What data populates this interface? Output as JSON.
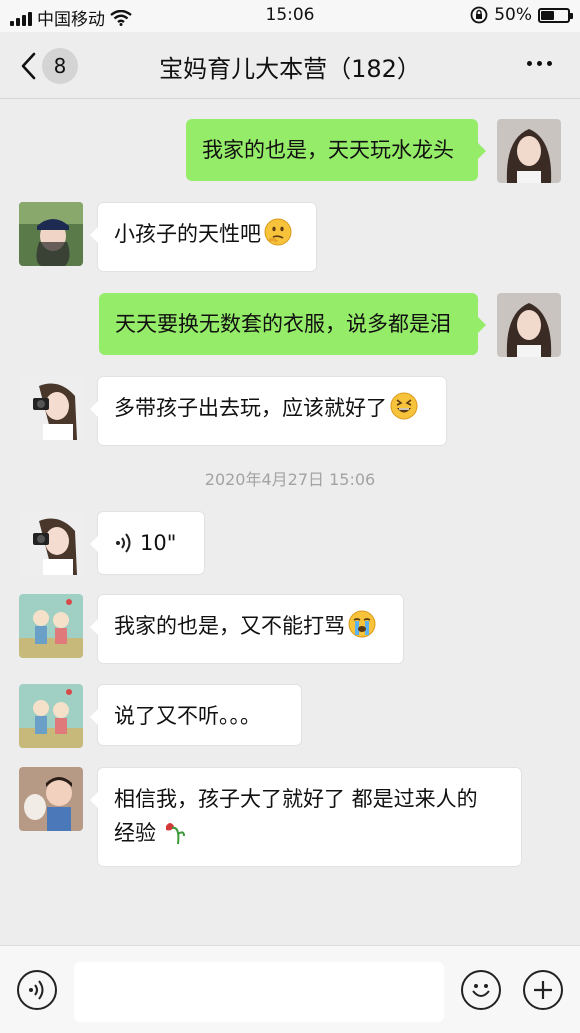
{
  "status_bar": {
    "carrier": "中国移动",
    "time": "15:06",
    "battery": "50%",
    "battery_level": 0.5
  },
  "nav": {
    "back_count": "8",
    "title": "宝妈育儿大本营（182）"
  },
  "messages": [
    {
      "side": "right",
      "text": "我家的也是，天天玩水龙头",
      "avatar": "avatar-girl-long-hair"
    },
    {
      "side": "left",
      "text": "小孩子的天性吧",
      "emoji": "thinking-face-emoji",
      "avatar": "avatar-girl-cap"
    },
    {
      "side": "right",
      "text": "天天要换无数套的衣服，说多都是泪",
      "avatar": "avatar-girl-long-hair"
    },
    {
      "side": "left",
      "text": "多带孩子出去玩，应该就好了",
      "emoji": "grinning-squint-emoji",
      "avatar": "avatar-girl-camera"
    },
    {
      "side": "left",
      "voice": "10\"",
      "avatar": "avatar-girl-camera"
    },
    {
      "side": "left",
      "text": "我家的也是，又不能打骂",
      "emoji": "crying-face-emoji",
      "avatar": "avatar-cartoon-couple"
    },
    {
      "side": "left",
      "text": "说了又不听。。。",
      "avatar": "avatar-cartoon-couple"
    },
    {
      "side": "left",
      "text_line1": "相信我，孩子大了就好了 都是过来人的",
      "text_line2": "经验",
      "emoji": "wilted-flower-emoji",
      "avatar": "avatar-child-dog"
    }
  ],
  "timestamp": "2020年4月27日 15:06",
  "input_bar": {
    "icons": [
      "voice-icon",
      "emoji-icon",
      "plus-icon"
    ]
  },
  "colors": {
    "self_bubble": "#95ec69",
    "other_bubble": "#ffffff",
    "background": "#ededed"
  }
}
